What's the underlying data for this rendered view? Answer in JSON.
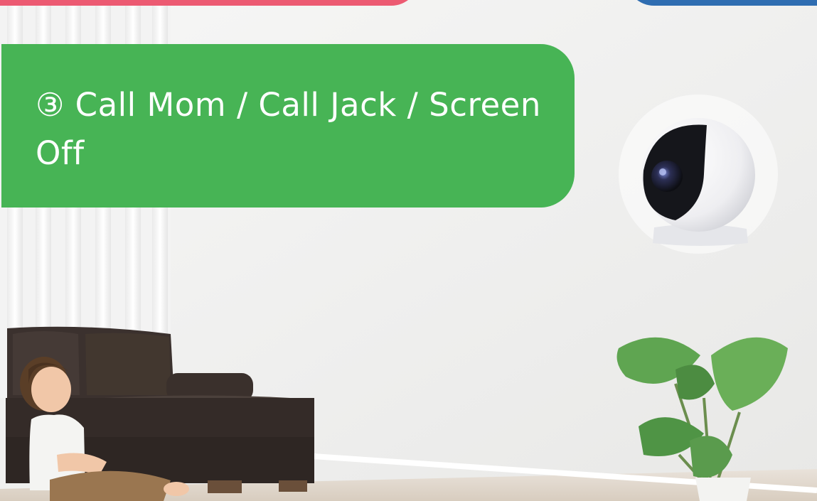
{
  "banner": {
    "text": "③ Call Mom / Call Jack / Screen Off"
  },
  "colors": {
    "top_left_pill": "#ec5a72",
    "top_right_pill": "#2f6db1",
    "banner": "#47b455",
    "banner_text": "#ffffff",
    "wall": "#f1f1f0",
    "sofa": "#3a302d",
    "plant": "#5e9f52",
    "camera_body": "#f4f4f6",
    "camera_lens": "#1b1c20"
  },
  "icons": {
    "camera": "security-camera-icon",
    "plant": "monstera-plant-icon",
    "sofa": "sofa-icon",
    "child": "child-figure-icon"
  }
}
